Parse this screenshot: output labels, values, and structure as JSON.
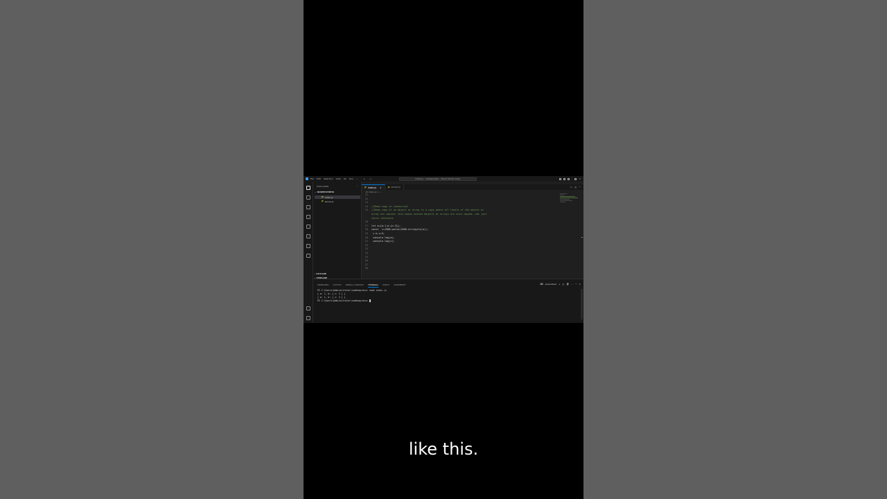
{
  "caption": "like this.",
  "titlebar": {
    "menu": [
      "File",
      "Edit",
      "Selection",
      "View",
      "Go",
      "Run",
      "..."
    ],
    "search": "index.js - nodeexpress - Visual Studio Code"
  },
  "sidebar": {
    "title": "EXPLORER",
    "more": "...",
    "folder": "NODEEXPRESS",
    "files": [
      {
        "badge": "JS",
        "name": "index.js"
      },
      {
        "badge": "JS",
        "name": "server.js"
      }
    ],
    "outline": "OUTLINE",
    "timeline": "TIMELINE"
  },
  "editor": {
    "tabs": [
      {
        "badge": "JS",
        "name": "index.js",
        "close": "×"
      },
      {
        "badge": "JS",
        "name": "server.js",
        "close": ""
      }
    ],
    "breadcrumb": "JS index.js > ...",
    "lines": [
      {
        "n": "11",
        "t": "",
        "type": "code"
      },
      {
        "n": "12",
        "t": "",
        "type": "code"
      },
      {
        "n": "13",
        "t": "",
        "type": "code"
      },
      {
        "n": "14",
        "t": "//Deep copy in javascript",
        "type": "comment"
      },
      {
        "n": "15",
        "t": "//Deep copy of an object or array is a copy where all levels of the object or",
        "type": "comment"
      },
      {
        "n": "",
        "t": "array are copied. this means nested objects or arrays are also copied..not just",
        "type": "comment"
      },
      {
        "n": "",
        "t": "there reference",
        "type": "comment"
      },
      {
        "n": "16",
        "t": "",
        "type": "code"
      },
      {
        "n": "17",
        "t": "let a={a:1,b:{c:2}};",
        "type": "code"
      },
      {
        "n": "18",
        "t": "const  c=JSON.parse(JSON.stringify(a));",
        "type": "code"
      },
      {
        "n": "19",
        "t": " c.b.c=3;",
        "type": "code"
      },
      {
        "n": "20",
        "t": " console.log(a);",
        "type": "code"
      },
      {
        "n": "21",
        "t": " console.log(c);",
        "type": "code"
      },
      {
        "n": "22",
        "t": "",
        "type": "code"
      },
      {
        "n": "23",
        "t": "",
        "type": "code"
      },
      {
        "n": "24",
        "t": "",
        "type": "code"
      },
      {
        "n": "25",
        "t": "",
        "type": "code"
      },
      {
        "n": "26",
        "t": "",
        "type": "code"
      },
      {
        "n": "27",
        "t": "",
        "type": "code"
      },
      {
        "n": "28",
        "t": "",
        "type": "code"
      }
    ]
  },
  "panel": {
    "tabs": [
      "PROBLEMS",
      "OUTPUT",
      "DEBUG CONSOLE",
      "TERMINAL",
      "PORTS",
      "COMMENTS"
    ],
    "active_tab": "TERMINAL",
    "shell": "powershell",
    "terminal_lines": [
      "PS C:\\Users\\Administrator\\nodeexpress> node index.js",
      "{ a: 1, b: { c: 2 } }",
      "{ a: 1, b: { c: 3 } }",
      "PS C:\\Users\\Administrator\\nodeexpress> "
    ]
  },
  "colors": {
    "accent": "#0078d4",
    "comment": "#6a9955",
    "js_badge": "#cbcb41"
  }
}
